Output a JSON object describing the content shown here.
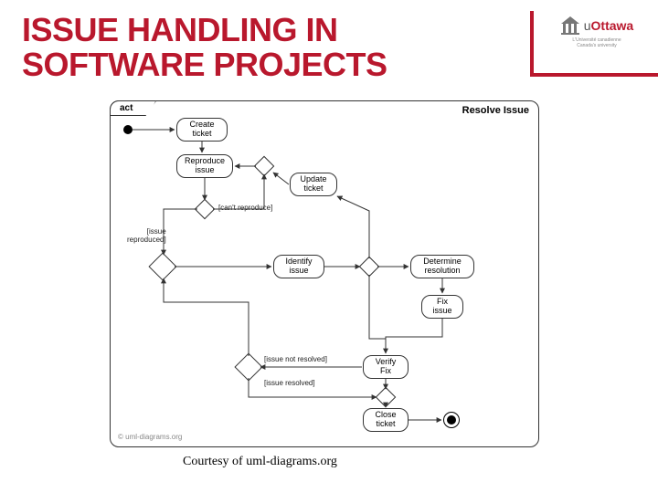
{
  "slide": {
    "title": "ISSUE HANDLING IN\nSOFTWARE PROJECTS",
    "courtesy": "Courtesy of uml-diagrams.org"
  },
  "brand": {
    "name_prefix": "u",
    "name_main": "Ottawa",
    "tagline": "L'Université canadienne\nCanada's university"
  },
  "diagram": {
    "frame_keyword": "act",
    "frame_title": "Resolve Issue",
    "watermark": "© uml-diagrams.org",
    "nodes": {
      "create_ticket": "Create\nticket",
      "reproduce_issue": "Reproduce\nissue",
      "update_ticket": "Update\nticket",
      "identify_issue": "Identify\nissue",
      "determine_resolution": "Determine\nresolution",
      "fix_issue": "Fix\nissue",
      "verify_fix": "Verify\nFix",
      "close_ticket": "Close\nticket"
    },
    "guards": {
      "cant_reproduce": "[can't reproduce]",
      "issue_reproduced": "[issue\nreproduced]",
      "issue_not_resolved": "[issue not resolved]",
      "issue_resolved": "[issue resolved]"
    }
  }
}
